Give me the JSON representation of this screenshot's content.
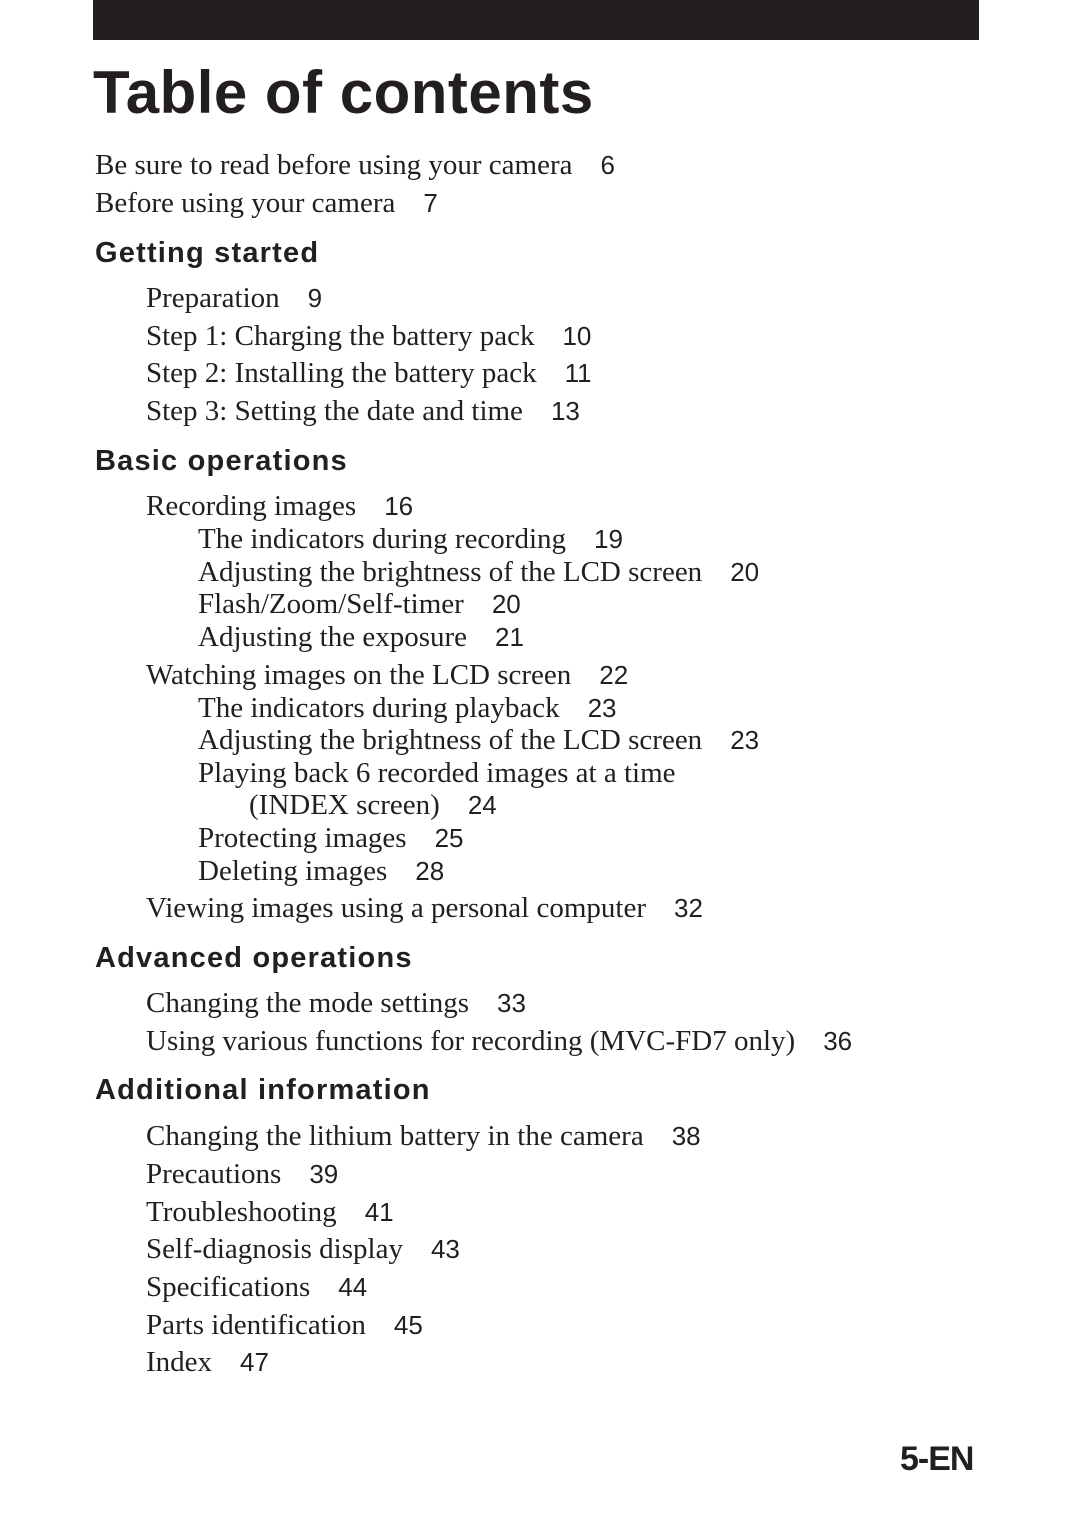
{
  "title": "Table of contents",
  "intro": [
    {
      "label": "Be sure to read before using your camera",
      "page": "6"
    },
    {
      "label": "Before using your camera",
      "page": "7"
    }
  ],
  "sections": [
    {
      "heading": "Getting started",
      "entries": [
        {
          "label": "Preparation",
          "page": "9"
        },
        {
          "label": "Step 1: Charging the battery pack",
          "page": "10"
        },
        {
          "label": "Step 2: Installing the battery pack",
          "page": "11"
        },
        {
          "label": "Step 3: Setting the date and time",
          "page": "13"
        }
      ]
    },
    {
      "heading": "Basic operations",
      "entries": [
        {
          "label": "Recording images",
          "page": "16"
        },
        {
          "label": "The indicators during recording",
          "page": "19"
        },
        {
          "label": "Adjusting the brightness of the LCD screen",
          "page": "20"
        },
        {
          "label": "Flash/Zoom/Self-timer",
          "page": "20"
        },
        {
          "label": "Adjusting the exposure",
          "page": "21"
        },
        {
          "label": "Watching images on the LCD screen",
          "page": "22"
        },
        {
          "label": "The indicators during playback",
          "page": "23"
        },
        {
          "label": "Adjusting the brightness of the LCD screen",
          "page": "23"
        },
        {
          "label": "Playing back 6 recorded images at a time",
          "page": ""
        },
        {
          "label": "(INDEX screen)",
          "page": "24"
        },
        {
          "label": "Protecting images",
          "page": "25"
        },
        {
          "label": "Deleting images",
          "page": "28"
        },
        {
          "label": "Viewing images using a personal computer",
          "page": "32"
        }
      ]
    },
    {
      "heading": "Advanced operations",
      "entries": [
        {
          "label": "Changing the mode settings",
          "page": "33"
        },
        {
          "label": "Using various functions for recording (MVC-FD7 only)",
          "page": "36"
        }
      ]
    },
    {
      "heading": "Additional information",
      "entries": [
        {
          "label": "Changing the lithium battery in the camera",
          "page": "38"
        },
        {
          "label": "Precautions",
          "page": "39"
        },
        {
          "label": "Troubleshooting",
          "page": "41"
        },
        {
          "label": "Self-diagnosis display",
          "page": "43"
        },
        {
          "label": "Specifications",
          "page": "44"
        },
        {
          "label": "Parts identification",
          "page": "45"
        },
        {
          "label": "Index",
          "page": "47"
        }
      ]
    }
  ],
  "footer": {
    "page_label": "5-EN"
  }
}
